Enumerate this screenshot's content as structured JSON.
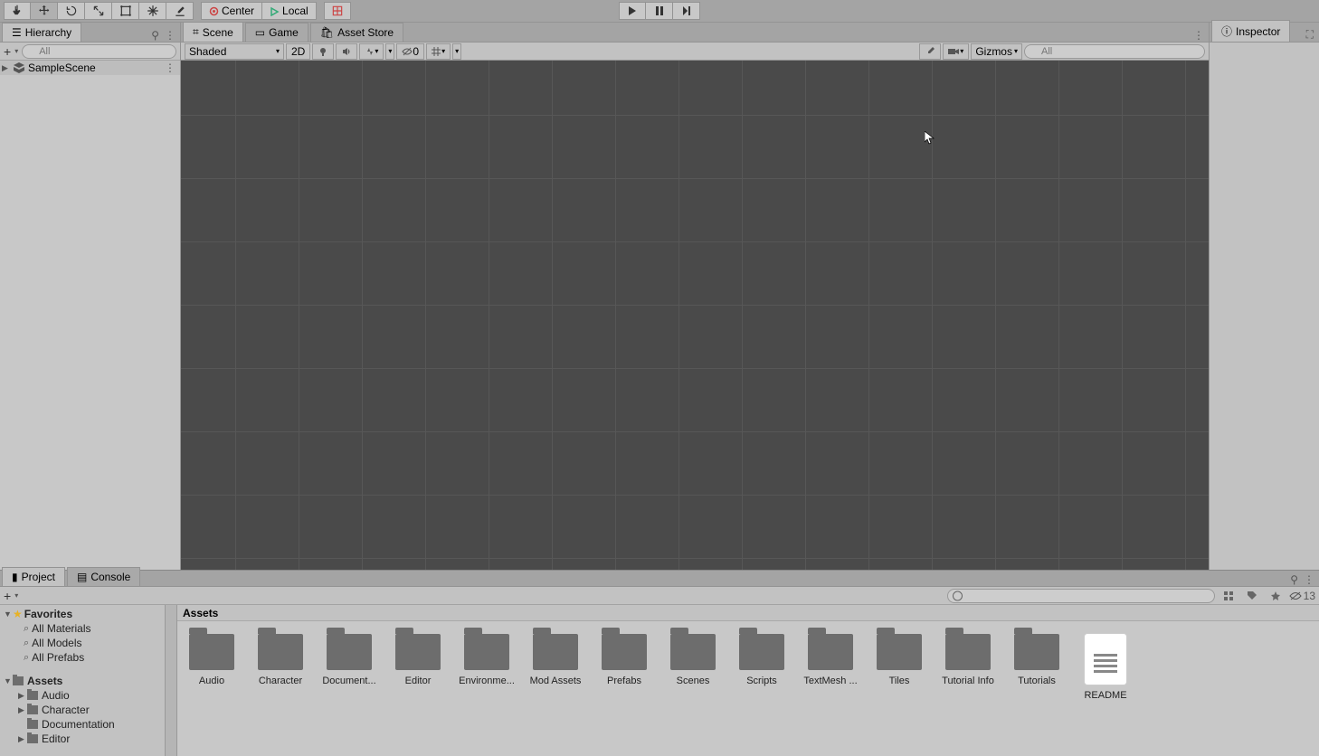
{
  "toolbar": {
    "pivot_center": "Center",
    "pivot_local": "Local"
  },
  "hierarchy": {
    "title": "Hierarchy",
    "search_placeholder": "All",
    "scene_name": "SampleScene"
  },
  "scene_tabs": {
    "scene": "Scene",
    "game": "Game",
    "asset_store": "Asset Store"
  },
  "scene_toolbar": {
    "shading": "Shaded",
    "mode2d": "2D",
    "hidden0": "0",
    "gizmos": "Gizmos",
    "search_placeholder": "All"
  },
  "inspector": {
    "title": "Inspector"
  },
  "project": {
    "project_tab": "Project",
    "console_tab": "Console",
    "hidden_count": "13",
    "breadcrumb": "Assets",
    "tree": {
      "favorites": "Favorites",
      "all_materials": "All Materials",
      "all_models": "All Models",
      "all_prefabs": "All Prefabs",
      "assets": "Assets",
      "audio": "Audio",
      "character": "Character",
      "documentation": "Documentation",
      "editor": "Editor"
    },
    "assets": [
      {
        "label": "Audio",
        "type": "folder"
      },
      {
        "label": "Character",
        "type": "folder"
      },
      {
        "label": "Document...",
        "type": "folder"
      },
      {
        "label": "Editor",
        "type": "folder"
      },
      {
        "label": "Environme...",
        "type": "folder"
      },
      {
        "label": "Mod Assets",
        "type": "folder"
      },
      {
        "label": "Prefabs",
        "type": "folder"
      },
      {
        "label": "Scenes",
        "type": "folder"
      },
      {
        "label": "Scripts",
        "type": "folder"
      },
      {
        "label": "TextMesh ...",
        "type": "folder"
      },
      {
        "label": "Tiles",
        "type": "folder"
      },
      {
        "label": "Tutorial Info",
        "type": "folder"
      },
      {
        "label": "Tutorials",
        "type": "folder"
      },
      {
        "label": "README",
        "type": "file"
      }
    ]
  }
}
